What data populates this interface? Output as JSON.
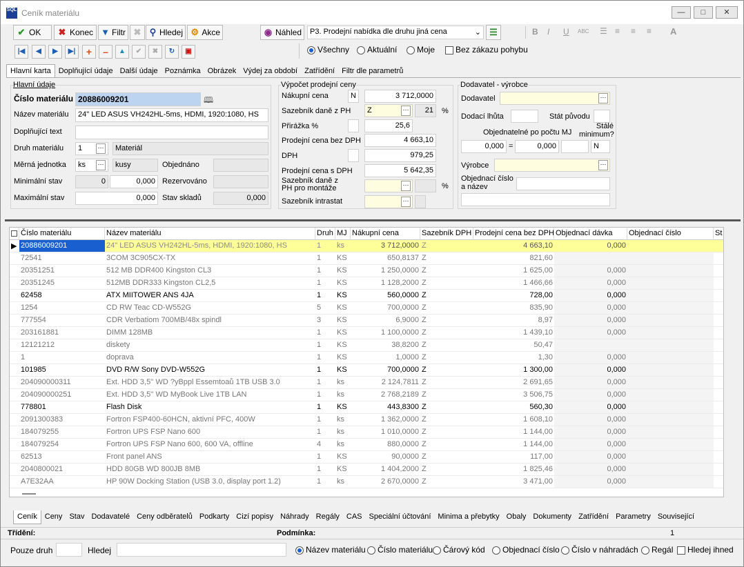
{
  "window": {
    "title": "Ceník materiálu",
    "logo": "SQL"
  },
  "toolbar": {
    "ok": "OK",
    "konec": "Konec",
    "filtr": "Filtr",
    "hledej": "Hledej",
    "akce": "Akce",
    "nahled": "Náhled",
    "report": "P3. Prodejní nabídka dle druhu jiná cena"
  },
  "filter_options": {
    "vsechny": "Všechny",
    "aktualni": "Aktuální",
    "moje": "Moje",
    "bez_zakazu": "Bez zákazu pohybu"
  },
  "tabs": [
    "Hlavní karta",
    "Doplňující údaje",
    "Další údaje",
    "Poznámka",
    "Obrázek",
    "Výdej za období",
    "Zatřídění",
    "Filtr dle parametrů"
  ],
  "main": {
    "group_title": "Hlavní údaje",
    "cislo_label": "Číslo materiálu",
    "cislo": "20886009201",
    "nazev_label": "Název materiálu",
    "nazev": "24\" LED ASUS VH242HL-5ms, HDMI, 1920:1080, HS",
    "doplnujici_label": "Doplňující text",
    "druh_label": "Druh materiálu",
    "druh": "1",
    "druh_text": "Materiál",
    "mj_label": "Měrná jednotka",
    "mj": "ks",
    "mj_text": "kusy",
    "objednano_label": "Objednáno",
    "min_label": "Minimální stav",
    "min_a": "0",
    "min_b": "0,000",
    "rezervovano_label": "Rezervováno",
    "max_label": "Maximální stav",
    "max": "0,000",
    "stav_label": "Stav skladů",
    "stav": "0,000"
  },
  "calc": {
    "group_title": "Výpočet prodejní ceny",
    "nakupni_label": "Nákupní cena",
    "nakupni_flag": "N",
    "nakupni": "3 712,0000",
    "sazebnik_label": "Sazebník daně z PH",
    "sazebnik": "Z",
    "sazba": "21",
    "pct": "%",
    "prirazka_label": "Přirážka %",
    "prirazka": "25,6",
    "prodejni_bez_label": "Prodejní cena bez DPH",
    "prodejni_bez": "4 663,10",
    "dph_label": "DPH",
    "dph": "979,25",
    "prodejni_s_label": "Prodejní cena s DPH",
    "prodejni_s": "5 642,35",
    "sazebnik_montaz_label": "Sazebník daně z PH pro montáže",
    "intrastat_label": "Sazebník intrastat"
  },
  "supplier": {
    "group_title": "Dodavatel - výrobce",
    "dodavatel_label": "Dodavatel",
    "lhuta_label": "Dodací lhůta",
    "stat_label": "Stát původu",
    "objednatelne_label": "Objednatelné po počtu MJ",
    "stale_label": "Stálé minimum?",
    "obj_a": "0,000",
    "eq": "=",
    "obj_b": "0,000",
    "stale": "N",
    "vyrobce_label": "Výrobce",
    "obj_cislo_label": "Objednací číslo a název"
  },
  "grid": {
    "columns": [
      "Číslo materiálu",
      "Název materiálu",
      "Druh",
      "MJ",
      "Nákupní cena",
      "Sazebník DPH",
      "Prodejní cena bez DPH",
      "Objednací dávka",
      "Objednací číslo",
      "St"
    ],
    "rows": [
      [
        "20886009201",
        "24\" LED ASUS VH242HL-5ms, HDMI, 1920:1080, HS",
        "1",
        "ks",
        "3 712,0000",
        "Z",
        "4 663,10",
        "0,000",
        ""
      ],
      [
        "72541",
        "3COM 3C905CX-TX",
        "1",
        "KS",
        "650,8137",
        "Z",
        "821,60",
        "",
        ""
      ],
      [
        "20351251",
        "512 MB DDR400 Kingston CL3",
        "1",
        "KS",
        "1 250,0000",
        "Z",
        "1 625,00",
        "0,000",
        ""
      ],
      [
        "20351245",
        "512MB DDR333 Kingston CL2,5",
        "1",
        "KS",
        "1 128,2000",
        "Z",
        "1 466,66",
        "0,000",
        ""
      ],
      [
        "62458",
        "ATX MIITOWER ANS 4JA",
        "1",
        "KS",
        "560,0000",
        "Z",
        "728,00",
        "0,000",
        ""
      ],
      [
        "1254",
        "CD RW Teac CD-W552G",
        "5",
        "KS",
        "700,0000",
        "Z",
        "835,90",
        "0,000",
        ""
      ],
      [
        "777554",
        "CDR Verbatiom 700MB/48x spindl",
        "3",
        "KS",
        "6,9000",
        "Z",
        "8,97",
        "0,000",
        ""
      ],
      [
        "203161881",
        "DIMM 128MB",
        "1",
        "KS",
        "1 100,0000",
        "Z",
        "1 439,10",
        "0,000",
        ""
      ],
      [
        "12121212",
        "diskety",
        "1",
        "KS",
        "38,8200",
        "Z",
        "50,47",
        "",
        ""
      ],
      [
        "1",
        "doprava",
        "1",
        "KS",
        "1,0000",
        "Z",
        "1,30",
        "0,000",
        ""
      ],
      [
        "101985",
        "DVD R/W Sony DVD-W552G",
        "1",
        "KS",
        "700,0000",
        "Z",
        "1 300,00",
        "0,000",
        ""
      ],
      [
        "204090000311",
        "Ext. HDD 3,5'' WD ?yBppl Essemtoaů 1TB USB 3.0",
        "1",
        "ks",
        "2 124,7811",
        "Z",
        "2 691,65",
        "0,000",
        ""
      ],
      [
        "204090000251",
        "Ext. HDD 3,5'' WD MyBook Live 1TB LAN",
        "1",
        "ks",
        "2 768,2189",
        "Z",
        "3 506,75",
        "0,000",
        ""
      ],
      [
        "778801",
        "Flash Disk",
        "1",
        "KS",
        "443,8300",
        "Z",
        "560,30",
        "0,000",
        ""
      ],
      [
        "2091300383",
        "Fortron FSP400-60HCN, aktivní PFC, 400W",
        "1",
        "ks",
        "1 362,0000",
        "Z",
        "1 608,10",
        "0,000",
        ""
      ],
      [
        "184079255",
        "Fortron UPS FSP Nano 600",
        "1",
        "ks",
        "1 010,0000",
        "Z",
        "1 144,00",
        "0,000",
        ""
      ],
      [
        "184079254",
        "Fortron UPS FSP Nano 600, 600 VA, offline",
        "4",
        "ks",
        "880,0000",
        "Z",
        "1 144,00",
        "0,000",
        ""
      ],
      [
        "62513",
        "Front panel ANS",
        "1",
        "KS",
        "90,0000",
        "Z",
        "117,00",
        "0,000",
        ""
      ],
      [
        "2040800021",
        "HDD 80GB WD 800JB 8MB",
        "1",
        "KS",
        "1 404,2000",
        "Z",
        "1 825,46",
        "0,000",
        ""
      ],
      [
        "A7E32AA",
        "HP 90W Docking Station (USB 3.0, display port 1.2)",
        "1",
        "ks",
        "2 670,0000",
        "Z",
        "3 471,00",
        "0,000",
        ""
      ]
    ]
  },
  "bottom_tabs": [
    "Ceník",
    "Ceny",
    "Stav",
    "Dodavatelé",
    "Ceny odběratelů",
    "Podkarty",
    "Cizí popisy",
    "Náhrady",
    "Regály",
    "CAS",
    "Speciální účtování",
    "Minima a přebytky",
    "Obaly",
    "Dokumenty",
    "Zatřídění",
    "Parametry",
    "Související"
  ],
  "status": {
    "trideni": "Třídění:",
    "podminka": "Podmínka:",
    "count": "1"
  },
  "search": {
    "pouze_druh": "Pouze druh",
    "hledej": "Hledej",
    "opt1": "Název materiálu",
    "opt2": "Číslo materiálu",
    "opt3": "Čárový kód",
    "opt4": "Objednací číslo",
    "opt5": "Číslo v náhradách",
    "opt6": "Regál",
    "opt7": "Hledej ihned"
  }
}
